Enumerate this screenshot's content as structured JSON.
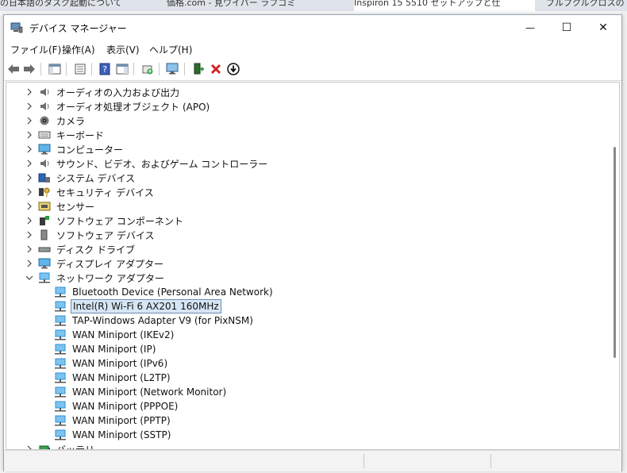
{
  "background": {
    "tabs": [
      "の日本語のタスク起動について",
      "価格.com - 見ワイパー ラフコミ",
      "Inspiron 15 5510 セットアップと仕",
      "ブルプクルクロスの"
    ]
  },
  "window": {
    "title": "デバイス マネージャー",
    "controls": {
      "minimize": "—",
      "maximize": "☐",
      "close": "✕"
    }
  },
  "menu": [
    "ファイル(F)",
    "操作(A)",
    "表示(V)",
    "ヘルプ(H)"
  ],
  "tree": {
    "categories": [
      {
        "label": "オーディオの入力および出力",
        "icon": "speaker-icon"
      },
      {
        "label": "オーディオ処理オブジェクト (APO)",
        "icon": "speaker-icon"
      },
      {
        "label": "カメラ",
        "icon": "camera-icon"
      },
      {
        "label": "キーボード",
        "icon": "keyboard-icon"
      },
      {
        "label": "コンピューター",
        "icon": "monitor-icon"
      },
      {
        "label": "サウンド、ビデオ、およびゲーム コントローラー",
        "icon": "speaker-icon"
      },
      {
        "label": "システム デバイス",
        "icon": "system-icon"
      },
      {
        "label": "セキュリティ デバイス",
        "icon": "key-icon"
      },
      {
        "label": "センサー",
        "icon": "sensor-icon"
      },
      {
        "label": "ソフトウェア コンポーネント",
        "icon": "component-icon"
      },
      {
        "label": "ソフトウェア デバイス",
        "icon": "device-icon"
      },
      {
        "label": "ディスク ドライブ",
        "icon": "disk-icon"
      },
      {
        "label": "ディスプレイ アダプター",
        "icon": "monitor-icon"
      },
      {
        "label": "ネットワーク アダプター",
        "icon": "network-icon"
      }
    ],
    "network_children": [
      "Bluetooth Device (Personal Area Network)",
      "Intel(R) Wi-Fi 6 AX201 160MHz",
      "TAP-Windows Adapter V9 (for PixNSM)",
      "WAN Miniport (IKEv2)",
      "WAN Miniport (IP)",
      "WAN Miniport (IPv6)",
      "WAN Miniport (L2TP)",
      "WAN Miniport (Network Monitor)",
      "WAN Miniport (PPPOE)",
      "WAN Miniport (PPTP)",
      "WAN Miniport (SSTP)"
    ],
    "selected_child": "Intel(R) Wi-Fi 6 AX201 160MHz",
    "last_category": {
      "label": "バッテリ",
      "icon": "battery-icon"
    }
  },
  "colors": {
    "accent": "#0a64ad",
    "selection": "#d7e6f5",
    "network_icon": "#2e8fd6"
  }
}
